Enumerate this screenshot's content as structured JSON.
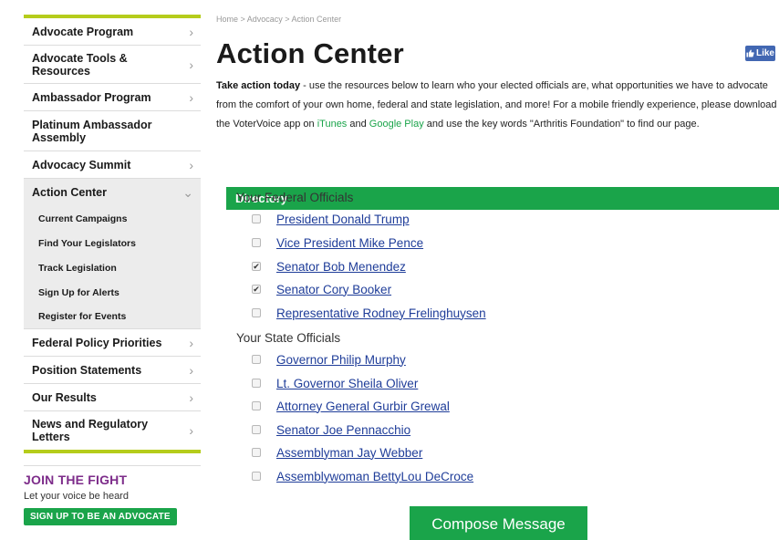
{
  "sidebar": {
    "items": [
      {
        "label": "Advocate Program"
      },
      {
        "label": "Advocate Tools & Resources"
      },
      {
        "label": "Ambassador Program"
      },
      {
        "label": "Platinum Ambassador Assembly"
      },
      {
        "label": "Advocacy Summit"
      },
      {
        "label": "Action Center"
      },
      {
        "label": "Federal Policy Priorities"
      },
      {
        "label": "Position Statements"
      },
      {
        "label": "Our Results"
      },
      {
        "label": "News and Regulatory Letters"
      }
    ],
    "subitems": [
      {
        "label": "Current Campaigns"
      },
      {
        "label": "Find Your Legislators"
      },
      {
        "label": "Track Legislation"
      },
      {
        "label": "Sign Up for Alerts"
      },
      {
        "label": "Register for Events"
      }
    ],
    "chevron_right": "›",
    "chevron_down": "⌄"
  },
  "join": {
    "title": "JOIN THE FIGHT",
    "subtitle": "Let your voice be heard",
    "button": "SIGN UP TO BE AN ADVOCATE"
  },
  "breadcrumb": "Home  >  Advocacy  >  Action Center",
  "page_title": "Action Center",
  "fb_like": {
    "label": "Like",
    "icon": "thumbs-up-icon"
  },
  "intro": {
    "bold": "Take action today",
    "text1": " - use the resources below to learn who your elected officials are, what opportunities we have to advocate from the comfort of your own home, federal and state legislation, and more! For a mobile friendly experience, please download the VoterVoice app on ",
    "link1": "iTunes",
    "text2": " and ",
    "link2": "Google Play",
    "text3": " and use the key words \"Arthritis Foundation\" to find our page."
  },
  "directory": {
    "header": "Directory",
    "federal_title": "Your Federal Officials",
    "federal": [
      {
        "name": "President Donald Trump",
        "checked": false
      },
      {
        "name": "Vice President Mike Pence",
        "checked": false
      },
      {
        "name": "Senator Bob Menendez",
        "checked": true
      },
      {
        "name": "Senator Cory Booker",
        "checked": true
      },
      {
        "name": "Representative Rodney Frelinghuysen",
        "checked": false
      }
    ],
    "state_title": "Your State Officials",
    "state": [
      {
        "name": "Governor Philip Murphy",
        "checked": false
      },
      {
        "name": "Lt. Governor Sheila Oliver",
        "checked": false
      },
      {
        "name": "Attorney General Gurbir Grewal",
        "checked": false
      },
      {
        "name": "Senator Joe Pennacchio",
        "checked": false
      },
      {
        "name": "Assemblyman Jay Webber",
        "checked": false
      },
      {
        "name": "Assemblywoman BettyLou DeCroce",
        "checked": false
      }
    ]
  },
  "compose_button": "Compose Message",
  "colors": {
    "accent_green": "#1aa44a",
    "bar_green": "#b5cc1b",
    "purple": "#7d2c8a",
    "link_blue": "#1f3d99"
  }
}
